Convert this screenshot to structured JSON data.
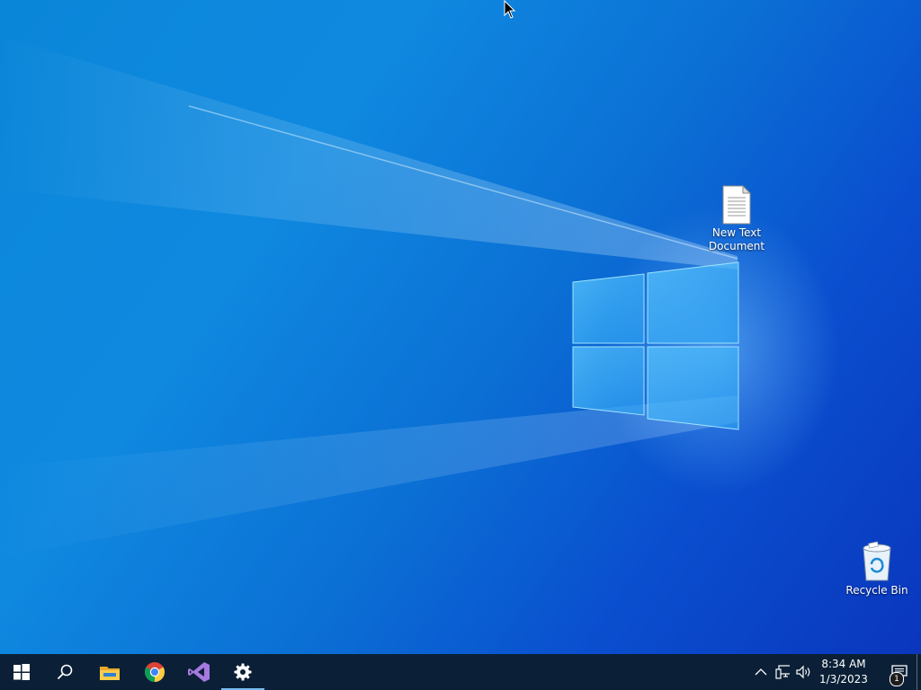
{
  "desktop": {
    "icons": [
      {
        "label": "New Text Document",
        "icon": "text-document-icon"
      },
      {
        "label": "Recycle Bin",
        "icon": "recycle-bin-icon"
      }
    ]
  },
  "taskbar": {
    "buttons": [
      {
        "name": "start",
        "icon": "windows-logo-icon"
      },
      {
        "name": "search",
        "icon": "search-icon"
      },
      {
        "name": "file-explorer",
        "icon": "folder-icon"
      },
      {
        "name": "chrome",
        "icon": "chrome-icon"
      },
      {
        "name": "visual-studio",
        "icon": "visual-studio-icon"
      },
      {
        "name": "settings",
        "icon": "gear-icon",
        "active": true
      }
    ],
    "tray": {
      "icons": [
        "chevron-up-icon",
        "network-icon",
        "volume-icon"
      ],
      "time": "8:34 AM",
      "date": "1/3/2023",
      "notification_count": "1"
    }
  },
  "colors": {
    "taskbar": "#0b2036",
    "desktop_accent": "#0a86d8",
    "active_indicator": "#76b9ed"
  }
}
